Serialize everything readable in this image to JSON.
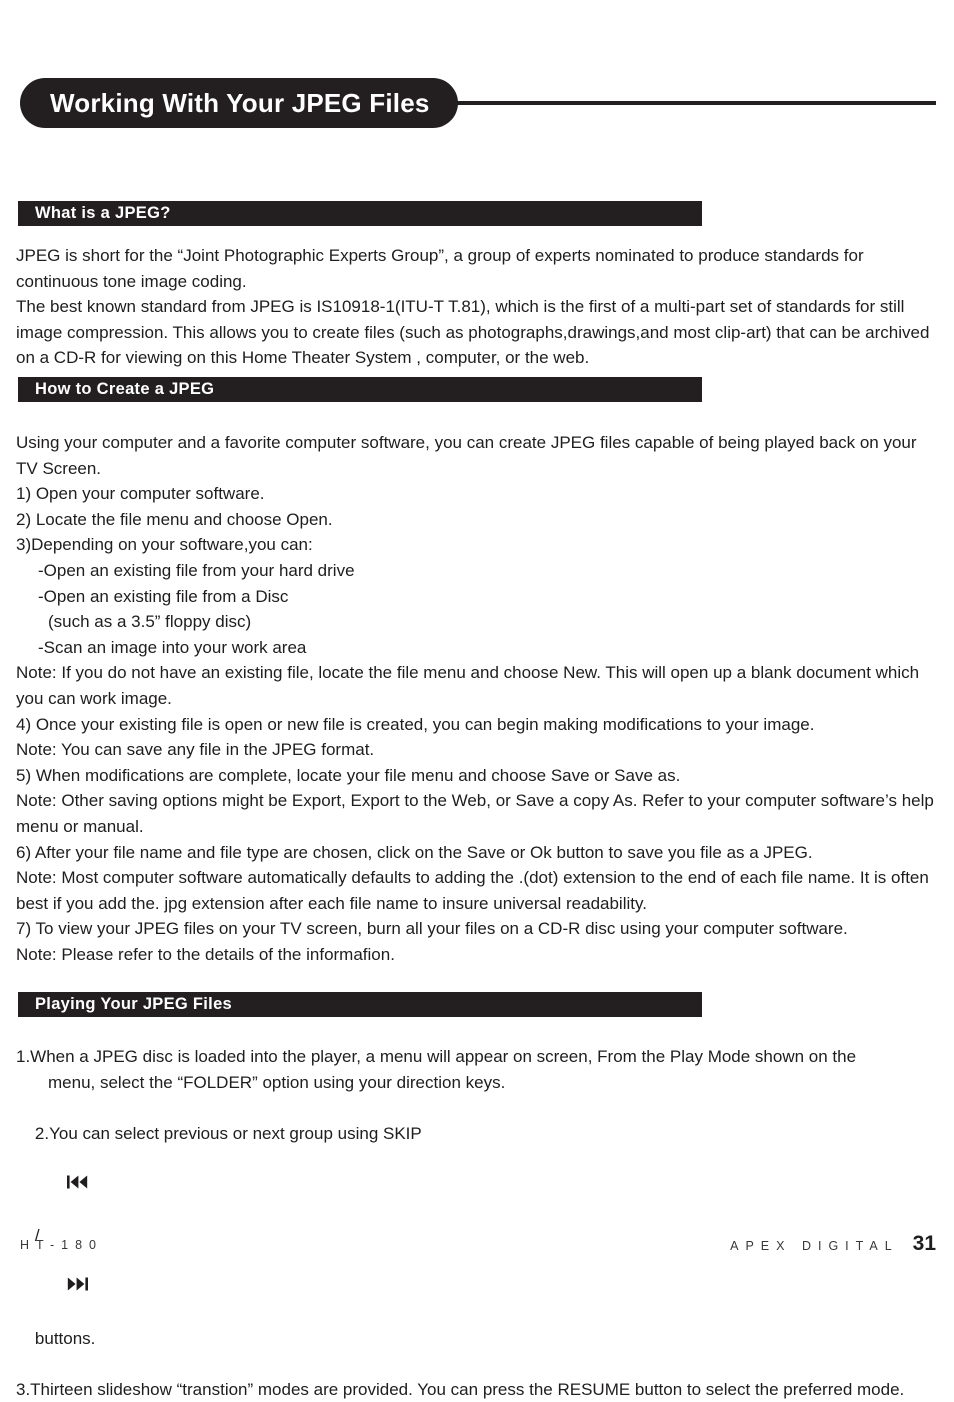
{
  "page": {
    "title": "Working With Your JPEG Files"
  },
  "sections": [
    {
      "heading": "What is a JPEG?",
      "paragraphs": [
        "JPEG is short for the “Joint Photographic Experts Group”, a group of experts nominated to produce standards for continuous tone image coding.",
        "The best known standard from JPEG is IS10918-1(ITU-T T.81), which is the first of a multi-part set of standards for still image compression. This allows you to create files (such as photographs,drawings,and most clip-art) that can be archived on a CD-R for viewing on this Home Theater System , computer, or the web."
      ]
    },
    {
      "heading": "How to Create a JPEG",
      "lines": [
        "Using your computer and a favorite computer software, you can create JPEG files capable of being played back on your TV Screen.",
        "1) Open your computer software.",
        "2) Locate the file menu and choose Open.",
        "3)Depending on your software,you can:",
        "-Open an existing file from your hard drive",
        "-Open an existing file from a Disc",
        "(such as a 3.5” floppy disc)",
        "-Scan an image into your work area",
        "Note: If you do not have an existing file, locate the file menu and choose New. This will open up a blank document which you can work image.",
        "4) Once your existing file is open or new file is created, you can begin making modifications to your image.",
        "Note: You can save any file in the JPEG format.",
        "5) When modifications are complete, locate your file menu and choose Save or Save as.",
        "Note: Other saving options might be Export, Export to the Web, or Save a copy As. Refer to your computer software’s help menu or manual.",
        "6) After your file name and file type are chosen, click on the Save or Ok button to save you file as a JPEG.",
        "Note: Most computer software automatically defaults to adding the .(dot) extension to the end of each file name. It is often best if you add the. jpg extension after each file name to insure universal readability.",
        "7) To view your JPEG files on your TV screen, burn all your files on a CD-R disc using your computer software.",
        "Note: Please refer to the details of the informafion."
      ]
    },
    {
      "heading": "Playing Your JPEG Files",
      "item1_a": "1.When a JPEG disc is loaded into the player, a menu will appear on screen, From the Play Mode shown on the",
      "item1_b": "menu, select the “FOLDER” option using your direction keys.",
      "item2_pre": "2.You can select previous or next group using SKIP",
      "item2_sep": "/",
      "item2_post": "buttons.",
      "item3": "3.Thirteen slideshow “transtion” modes are provided. You can press the RESUME button to select the preferred mode.",
      "icons": {
        "skip_previous": "skip-previous-icon",
        "skip_next": "skip-next-icon"
      }
    }
  ],
  "footer": {
    "model": "HT-180",
    "brand": "APEX DIGITAL",
    "page_number": "31"
  },
  "colors": {
    "ink": "#231f20",
    "paper": "#ffffff"
  }
}
